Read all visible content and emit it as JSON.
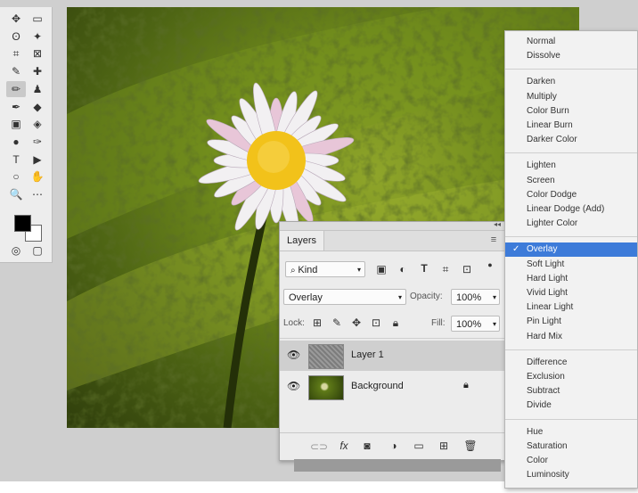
{
  "tools": {
    "icons": [
      "move-icon",
      "marquee-icon",
      "lasso-icon",
      "magic-wand-icon",
      "crop-icon",
      "frame-icon",
      "eyedropper-icon",
      "healing-icon",
      "brush-icon",
      "stamp-icon",
      "history-brush-icon",
      "eraser-icon",
      "gradient-icon",
      "paint-bucket-icon",
      "blur-icon",
      "pen-icon",
      "type-icon",
      "path-select-icon",
      "shape-icon",
      "hand-icon",
      "zoom-icon",
      "more-icon",
      "quickmask-icon",
      "screenmode-icon"
    ],
    "glyphs": [
      "✥",
      "▭",
      "ʘ",
      "✦",
      "⌗",
      "⊠",
      "✎",
      "✚",
      "✏",
      "♟",
      "✒",
      "◆",
      "▣",
      "◈",
      "●",
      "✑",
      "T",
      "▶",
      "○",
      "✋",
      "🔍",
      "⋯",
      "◎",
      "▢"
    ]
  },
  "layers_panel": {
    "tab_label": "Layers",
    "filter_kind": "Kind",
    "blend_mode": "Overlay",
    "opacity_label": "Opacity:",
    "opacity_value": "100%",
    "lock_label": "Lock:",
    "fill_label": "Fill:",
    "fill_value": "100%",
    "layers": [
      {
        "name": "Layer 1",
        "selected": true,
        "locked": false
      },
      {
        "name": "Background",
        "selected": false,
        "locked": true
      }
    ],
    "bottom_icons": [
      "link-icon",
      "fx-icon",
      "mask-icon",
      "adjustment-icon",
      "folder-icon",
      "new-layer-icon",
      "trash-icon"
    ],
    "fx_label": "fx"
  },
  "blend_menu": {
    "groups": [
      [
        "Normal",
        "Dissolve"
      ],
      [
        "Darken",
        "Multiply",
        "Color Burn",
        "Linear Burn",
        "Darker Color"
      ],
      [
        "Lighten",
        "Screen",
        "Color Dodge",
        "Linear Dodge (Add)",
        "Lighter Color"
      ],
      [
        "Overlay",
        "Soft Light",
        "Hard Light",
        "Vivid Light",
        "Linear Light",
        "Pin Light",
        "Hard Mix"
      ],
      [
        "Difference",
        "Exclusion",
        "Subtract",
        "Divide"
      ],
      [
        "Hue",
        "Saturation",
        "Color",
        "Luminosity"
      ]
    ],
    "selected": "Overlay",
    "check": "✓"
  },
  "colors": {
    "accent": "#3d7bd9",
    "flower_center": "#f2c21a",
    "petals": "#f2f0f2"
  }
}
